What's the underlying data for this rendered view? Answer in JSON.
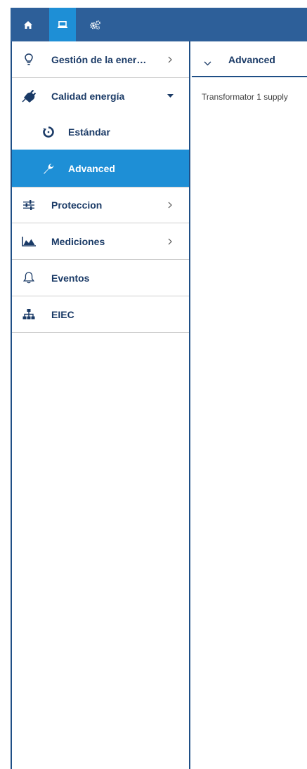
{
  "colors": {
    "topbar": "#2d5f99",
    "accent": "#1e8fd6",
    "text": "#1a3a66",
    "border": "#1f4f86"
  },
  "topbar": {
    "buttons": [
      {
        "icon": "home-icon"
      },
      {
        "icon": "laptop-icon",
        "active": true
      },
      {
        "icon": "gears-icon"
      }
    ]
  },
  "sidebar": {
    "items": [
      {
        "label": "Gestión de la ener…",
        "icon": "lightbulb-icon",
        "chevron": "right"
      },
      {
        "label": "Calidad energía",
        "icon": "plug-icon",
        "chevron": "down"
      },
      {
        "label": "Estándar",
        "icon": "recycle-icon"
      },
      {
        "label": "Advanced",
        "icon": "wrench-icon",
        "active": true
      },
      {
        "label": "Proteccion",
        "icon": "sliders-icon",
        "chevron": "right"
      },
      {
        "label": "Mediciones",
        "icon": "area-chart-icon",
        "chevron": "right"
      },
      {
        "label": "Eventos",
        "icon": "bell-icon"
      },
      {
        "label": "EIEC",
        "icon": "sitemap-icon"
      }
    ]
  },
  "main": {
    "header": "Advanced",
    "line": "Transformator 1 supply"
  }
}
